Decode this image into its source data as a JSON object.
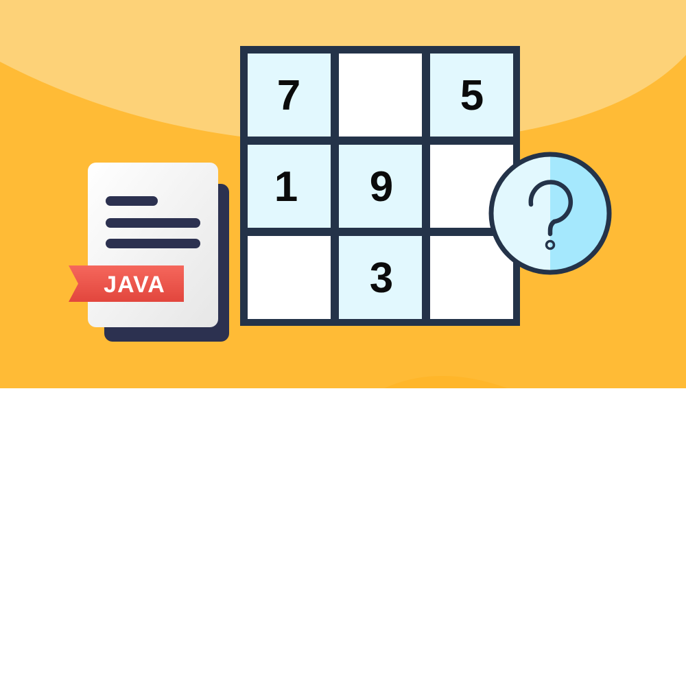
{
  "illustration": {
    "file_badge": "JAVA",
    "grid_cells": [
      "7",
      "",
      "5",
      "1",
      "9",
      "",
      "",
      "3",
      ""
    ],
    "help_icon": "question-mark-icon",
    "colors": {
      "background": "#FFBB36",
      "background_arc": "#FDD278",
      "grid_border": "#243349",
      "filled_cell": "#E2F8FE",
      "empty_cell": "#FFFFFF",
      "badge": "#F0554B",
      "document": "#F2F2F2",
      "document_back": "#2C3150"
    }
  }
}
